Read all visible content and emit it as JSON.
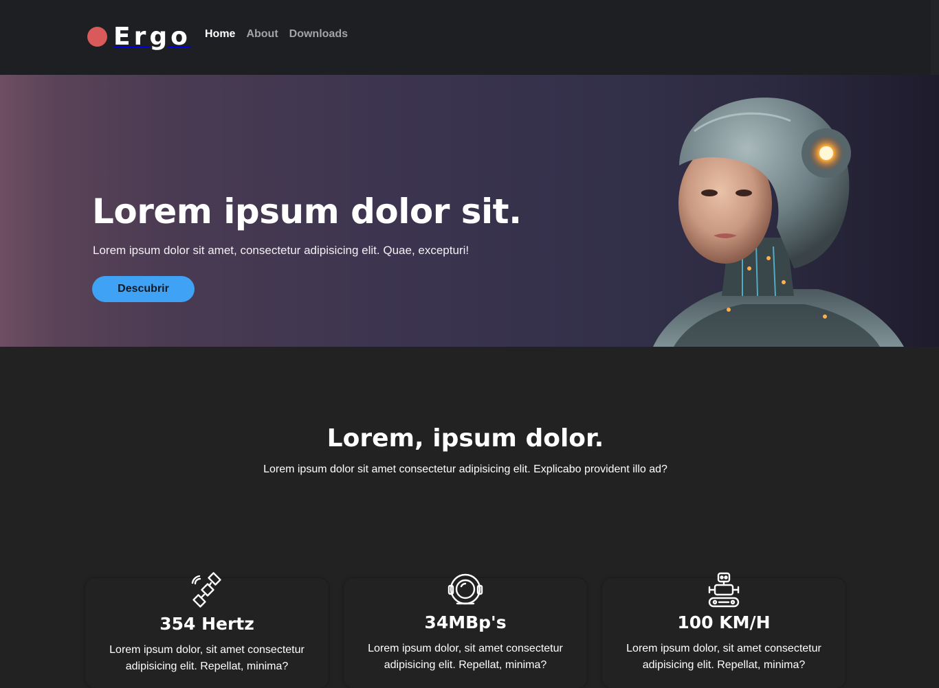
{
  "brand": {
    "name": "Ergo",
    "dot_color": "#d85a5a"
  },
  "nav": {
    "items": [
      {
        "label": "Home",
        "active": true
      },
      {
        "label": "About",
        "active": false
      },
      {
        "label": "Downloads",
        "active": false
      }
    ]
  },
  "hero": {
    "title": "Lorem ipsum dolor sit.",
    "subtitle": "Lorem ipsum dolor sit amet, consectetur adipisicing elit. Quae, excepturi!",
    "button_label": "Descubrir",
    "button_color": "#3fa2f4",
    "image_icon": "robot-woman-portrait"
  },
  "features": {
    "title": "Lorem, ipsum dolor.",
    "subtitle": "Lorem ipsum dolor sit amet consectetur adipisicing elit. Explicabo provident illo ad?",
    "cards": [
      {
        "icon": "satellite-icon",
        "title": "354 Hertz",
        "text": "Lorem ipsum dolor, sit amet consectetur adipisicing elit. Repellat, minima?"
      },
      {
        "icon": "astronaut-helmet-icon",
        "title": "34MBp's",
        "text": "Lorem ipsum dolor, sit amet consectetur adipisicing elit. Repellat, minima?"
      },
      {
        "icon": "robot-icon",
        "title": "100 KM/H",
        "text": "Lorem ipsum dolor, sit amet consectetur adipisicing elit. Repellat, minima?"
      }
    ]
  }
}
